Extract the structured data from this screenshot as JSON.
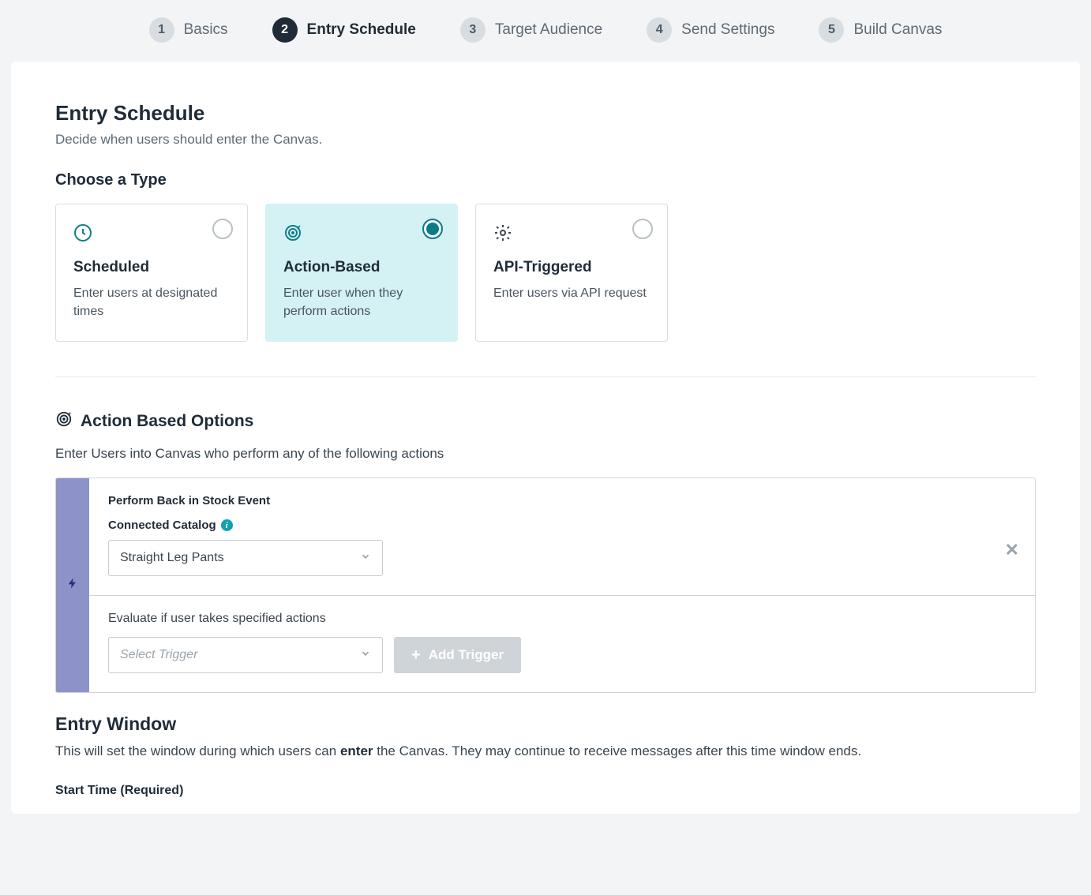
{
  "stepper": {
    "steps": [
      {
        "num": "1",
        "label": "Basics"
      },
      {
        "num": "2",
        "label": "Entry Schedule"
      },
      {
        "num": "3",
        "label": "Target Audience"
      },
      {
        "num": "4",
        "label": "Send Settings"
      },
      {
        "num": "5",
        "label": "Build Canvas"
      }
    ],
    "active_index": 1
  },
  "header": {
    "title": "Entry Schedule",
    "subtitle": "Decide when users should enter the Canvas."
  },
  "choose_type": {
    "title": "Choose a Type",
    "cards": [
      {
        "title": "Scheduled",
        "desc": "Enter users at designated times",
        "selected": false
      },
      {
        "title": "Action-Based",
        "desc": "Enter user when they perform actions",
        "selected": true
      },
      {
        "title": "API-Triggered",
        "desc": "Enter users via API request",
        "selected": false
      }
    ]
  },
  "action_options": {
    "title": "Action Based Options",
    "subtitle": "Enter Users into Canvas who perform any of the following actions",
    "event_heading": "Perform Back in Stock Event",
    "catalog_label": "Connected Catalog",
    "catalog_value": "Straight Leg Pants",
    "evaluate_text": "Evaluate if user takes specified actions",
    "trigger_placeholder": "Select Trigger",
    "add_trigger_label": "Add Trigger"
  },
  "entry_window": {
    "title": "Entry Window",
    "text_pre": "This will set the window during which users can ",
    "text_bold": "enter",
    "text_post": " the Canvas. They may continue to receive messages after this time window ends.",
    "start_label": "Start Time (Required)"
  }
}
